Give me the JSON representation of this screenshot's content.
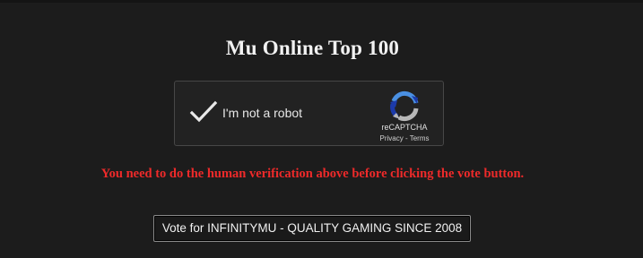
{
  "page": {
    "title": "Mu Online Top 100"
  },
  "captcha": {
    "label": "I'm not a robot",
    "checked": true,
    "brand": "reCAPTCHA",
    "privacy_link": "Privacy",
    "separator": " - ",
    "terms_link": "Terms",
    "check_icon": "checkmark-icon",
    "logo_icon": "recaptcha-logo-icon"
  },
  "warning": {
    "text": "You need to do the human verification above before clicking the vote button."
  },
  "vote": {
    "label": "Vote for INFINITYMU - QUALITY GAMING SINCE 2008"
  },
  "colors": {
    "background": "#1c1c1c",
    "warning": "#ee2a2a",
    "captcha_check": "#e8e8e8",
    "recaptcha_blue": "#4a90e2",
    "recaptcha_dark_blue": "#1c3aa9",
    "recaptcha_gray": "#b8b8b8"
  }
}
